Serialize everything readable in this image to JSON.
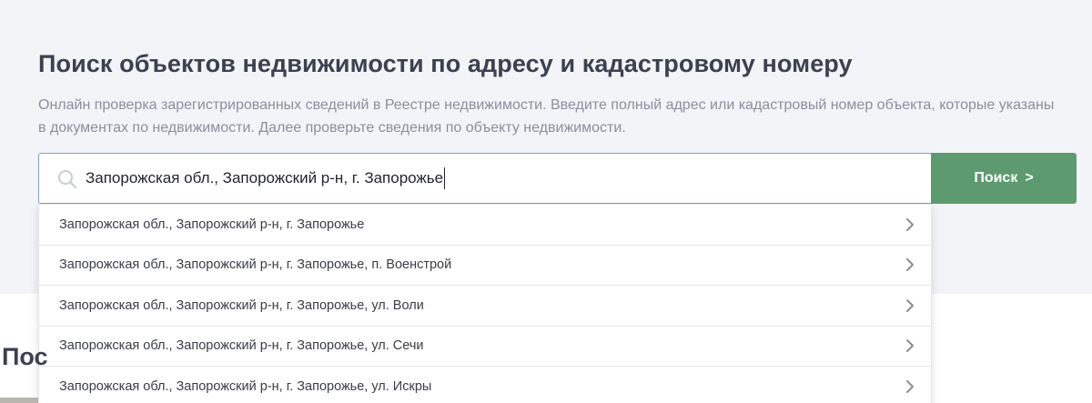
{
  "hero": {
    "title": "Поиск объектов недвижимости по адресу и кадастровому номеру",
    "description": "Онлайн проверка зарегистрированных сведений в Реестре недвижимости. Введите полный адрес или кадастровый номер объекта, которые указаны в документах по недвижимости. Далее проверьте сведения по объекту недвижимости."
  },
  "search": {
    "value": "Запорожская обл., Запорожский р-н, г. Запорожье",
    "icon": "search-icon",
    "button_label": "Поиск",
    "button_arrow": ">"
  },
  "suggestions": [
    "Запорожская обл., Запорожский р-н, г. Запорожье",
    "Запорожская обл., Запорожский р-н, г. Запорожье, п. Военстрой",
    "Запорожская обл., Запорожский р-н, г. Запорожье, ул. Воли",
    "Запорожская обл., Запорожский р-н, г. Запорожье, ул. Сечи",
    "Запорожская обл., Запорожский р-н, г. Запорожье, ул. Искры"
  ],
  "next_section": {
    "heading_partial": "Пос"
  },
  "colors": {
    "hero_bg": "#f3f4f8",
    "button_bg": "#5e9a6f",
    "input_border": "#7fa2c4"
  }
}
